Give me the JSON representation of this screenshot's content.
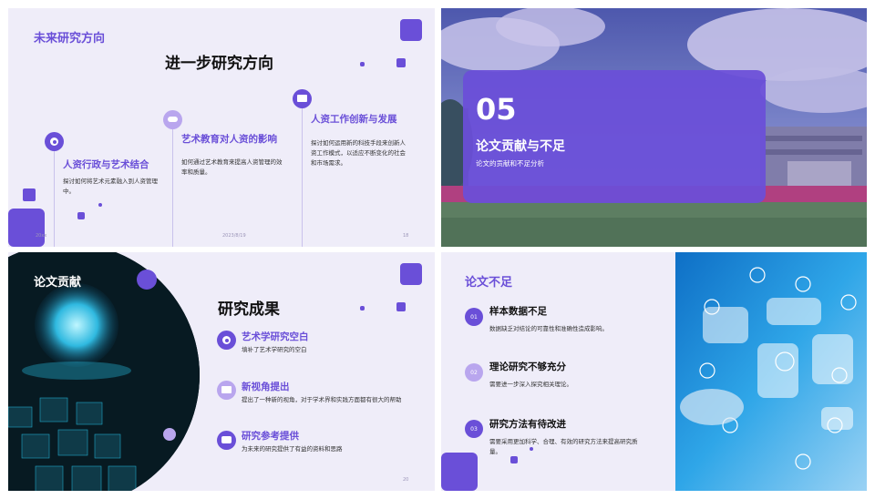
{
  "s1": {
    "header": "未来研究方向",
    "title": "进一步研究方向",
    "items": [
      {
        "title": "人资行政与艺术结合",
        "desc": "探讨如何将艺术元素融入到人资管理中。"
      },
      {
        "title": "艺术教育对人资的影响",
        "desc": "如何通过艺术教育来提高人资管理的效率和质量。"
      },
      {
        "title": "人资工作创新与发展",
        "desc": "探讨如何运用新的科技手段来创新人资工作模式，以适应不断变化的社会和市场需求。"
      }
    ],
    "footer_left": "20xx",
    "footer_date": "2023/8/19",
    "footer_page": "18"
  },
  "s2": {
    "number": "05",
    "title": "论文贡献与不足",
    "subtitle": "论文的贡献和不足分析"
  },
  "s3": {
    "header": "论文贡献",
    "title": "研究成果",
    "items": [
      {
        "title": "艺术学研究空白",
        "desc": "填补了艺术学研究的空白"
      },
      {
        "title": "新视角提出",
        "desc": "提出了一种新的视角，对于学术界和实践方面都有很大的帮助"
      },
      {
        "title": "研究参考提供",
        "desc": "为未来的研究提供了有益的资料和思路"
      }
    ],
    "footer_page": "20"
  },
  "s4": {
    "header": "论文不足",
    "items": [
      {
        "num": "01",
        "title": "样本数据不足",
        "desc": "数据缺乏对结论的可靠性和准确性造成影响。"
      },
      {
        "num": "02",
        "title": "理论研究不够充分",
        "desc": "需要进一步深入探究相关理论。"
      },
      {
        "num": "03",
        "title": "研究方法有待改进",
        "desc": "需要采用更加科学、合理、有效的研究方法来提高研究质量。"
      }
    ]
  },
  "colors": {
    "accent": "#6a4fd8",
    "light_accent": "#b9a6ee",
    "background": "#efedf9"
  }
}
